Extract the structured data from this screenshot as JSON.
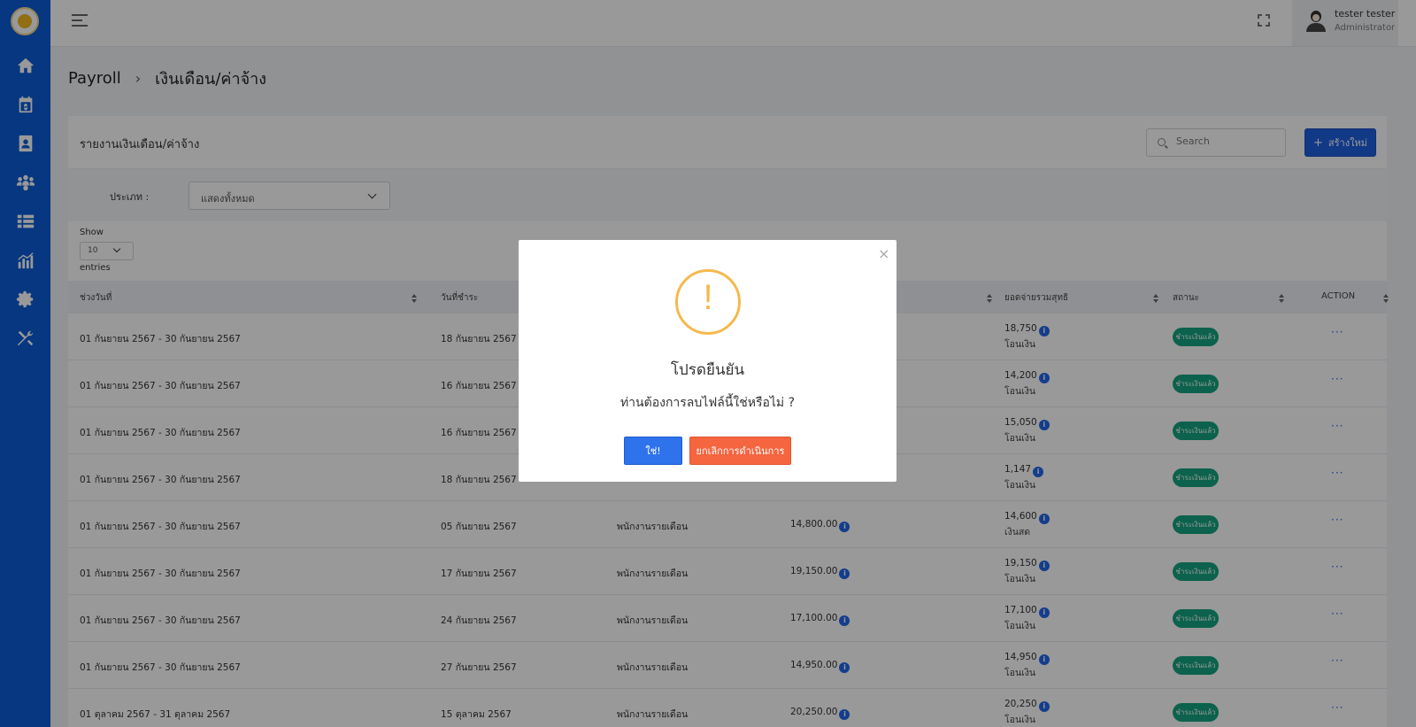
{
  "header": {
    "user_name": "tester tester",
    "user_role": "Administrator"
  },
  "breadcrumb": {
    "root": "Payroll",
    "separator": "›",
    "current": "เงินเดือน/ค่าจ้าง"
  },
  "card": {
    "title": "รายงานเงินเดือน/ค่าจ้าง",
    "search_placeholder": "Search",
    "create_label": "สร้างใหม่",
    "create_icon": "+"
  },
  "filter": {
    "label": "ประเภท :",
    "selected": "แสดงทั้งหมด"
  },
  "pagination": {
    "show_label": "Show",
    "page_size": "10",
    "entries_label": "entries"
  },
  "table": {
    "columns": [
      "ช่วงวันที่",
      "วันที่ชำระ",
      "ยอดจ่ายรวมสุทธิ",
      "สถานะ",
      "ACTION"
    ],
    "rows": [
      {
        "period": "01 กันยายน 2567 - 30 กันยายน 2567",
        "paid_date": "18 กันยายน 2567",
        "type": "",
        "salary": "",
        "net": "18,750",
        "method": "โอนเงิน",
        "status": "ชำระเงินแล้ว"
      },
      {
        "period": "01 กันยายน 2567 - 30 กันยายน 2567",
        "paid_date": "16 กันยายน 2567",
        "type": "",
        "salary": "",
        "net": "14,200",
        "method": "โอนเงิน",
        "status": "ชำระเงินแล้ว"
      },
      {
        "period": "01 กันยายน 2567 - 30 กันยายน 2567",
        "paid_date": "16 กันยายน 2567",
        "type": "",
        "salary": "",
        "net": "15,050",
        "method": "โอนเงิน",
        "status": "ชำระเงินแล้ว"
      },
      {
        "period": "01 กันยายน 2567 - 30 กันยายน 2567",
        "paid_date": "18 กันยายน 2567",
        "type": "",
        "salary": "",
        "net": "1,147",
        "method": "โอนเงิน",
        "status": "ชำระเงินแล้ว"
      },
      {
        "period": "01 กันยายน 2567 - 30 กันยายน 2567",
        "paid_date": "05 กันยายน 2567",
        "type": "พนักงานรายเดือน",
        "salary": "14,800.00",
        "net": "14,600",
        "method": "เงินสด",
        "status": "ชำระเงินแล้ว"
      },
      {
        "period": "01 กันยายน 2567 - 30 กันยายน 2567",
        "paid_date": "17 กันยายน 2567",
        "type": "พนักงานรายเดือน",
        "salary": "19,150.00",
        "net": "19,150",
        "method": "โอนเงิน",
        "status": "ชำระเงินแล้ว"
      },
      {
        "period": "01 กันยายน 2567 - 30 กันยายน 2567",
        "paid_date": "24 กันยายน 2567",
        "type": "พนักงานรายเดือน",
        "salary": "17,100.00",
        "net": "17,100",
        "method": "โอนเงิน",
        "status": "ชำระเงินแล้ว"
      },
      {
        "period": "01 กันยายน 2567 - 30 กันยายน 2567",
        "paid_date": "27 กันยายน 2567",
        "type": "พนักงานรายเดือน",
        "salary": "14,950.00",
        "net": "14,950",
        "method": "โอนเงิน",
        "status": "ชำระเงินแล้ว"
      },
      {
        "period": "01 ตุลาคม 2567 - 31 ตุลาคม 2567",
        "paid_date": "15 ตุลาคม 2567",
        "type": "พนักงานรายเดือน",
        "salary": "20,250.00",
        "net": "20,250",
        "method": "โอนเงิน",
        "status": "ชำระเงินแล้ว"
      }
    ],
    "info_glyph": "i",
    "action_glyph": "···"
  },
  "modal": {
    "icon_glyph": "!",
    "title": "โปรดยืนยัน",
    "message": "ท่านต้องการลบไฟล์นี้ใช่หรือไม่ ?",
    "confirm_label": "ใช่!",
    "cancel_label": "ยกเลิกการดำเนินการ",
    "close_glyph": "×"
  },
  "colors": {
    "sidebar": "#0b5cd5",
    "primary": "#1d5fe0",
    "status_paid": "#14a37f",
    "cancel": "#f56540",
    "warning": "#f5b94f"
  },
  "icons": [
    "home-icon",
    "payroll-calendar-icon",
    "contacts-icon",
    "team-gear-icon",
    "list-icon",
    "chart-icon",
    "settings-icon",
    "tools-icon"
  ]
}
